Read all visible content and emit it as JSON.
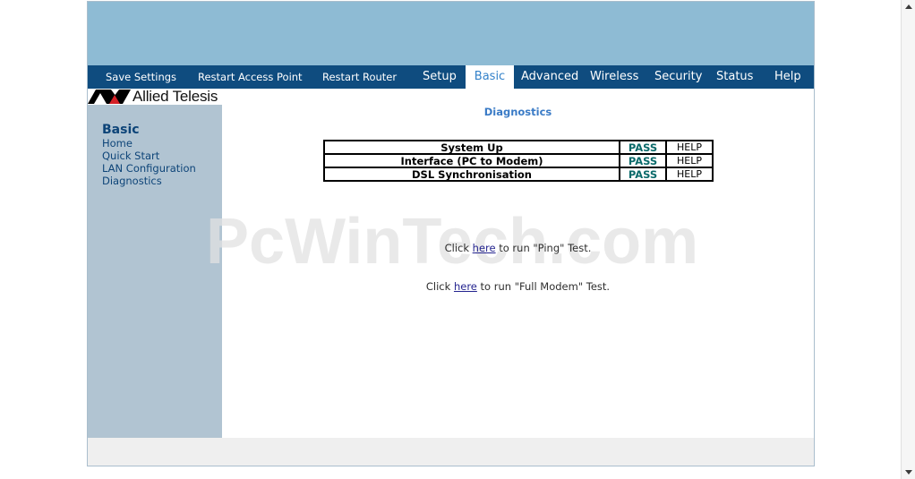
{
  "colors": {
    "header_banner": "#8ebbd4",
    "nav_bar": "#0f4c7f",
    "nav_text": "#ffffff",
    "nav_active_text": "#3482ca",
    "sidebar": "#b1c4d2",
    "sidebar_text": "#0d4478",
    "title": "#3a7bc6",
    "pass_status": "#0a6a6a",
    "link": "#24248f",
    "footer": "#efefef",
    "logo_red": "#d42027"
  },
  "scrollbar": {
    "up_icon": "arrow-up",
    "down_icon": "arrow-down"
  },
  "nav": {
    "items": [
      {
        "label": "Save Settings",
        "active": false
      },
      {
        "label": "Restart Access Point",
        "active": false
      },
      {
        "label": "Restart Router",
        "active": false
      },
      {
        "label": "Setup",
        "active": false
      },
      {
        "label": "Basic",
        "active": true
      },
      {
        "label": "Advanced",
        "active": false
      },
      {
        "label": "Wireless",
        "active": false
      },
      {
        "label": "Security",
        "active": false
      },
      {
        "label": "Status",
        "active": false
      },
      {
        "label": "Help",
        "active": false
      }
    ]
  },
  "logo": {
    "icon": "allied-telesis-mark",
    "text": "Allied Telesis"
  },
  "sidebar": {
    "heading": "Basic",
    "links": [
      "Home",
      "Quick Start",
      "LAN Configuration",
      "Diagnostics"
    ]
  },
  "main": {
    "title": "Diagnostics",
    "tests": [
      {
        "name": "System Up",
        "status": "PASS",
        "help": "HELP"
      },
      {
        "name": "Interface (PC to Modem)",
        "status": "PASS",
        "help": "HELP"
      },
      {
        "name": "DSL Synchronisation",
        "status": "PASS",
        "help": "HELP"
      }
    ],
    "ping_test": {
      "before": "Click",
      "link": "here",
      "after": "to run \"Ping\" Test."
    },
    "full_modem_test": {
      "before": "Click",
      "link": "here",
      "after": "to run \"Full Modem\" Test."
    }
  },
  "watermark": "PcWinTech.com"
}
